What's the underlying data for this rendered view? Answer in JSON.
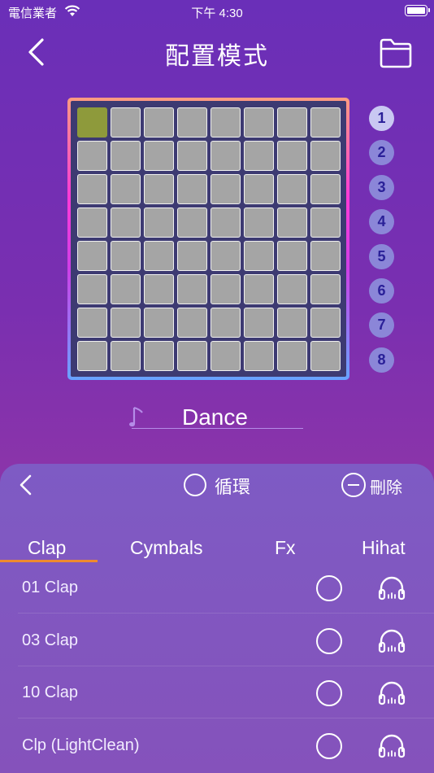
{
  "status_bar": {
    "carrier": "電信業者",
    "time": "下午 4:30"
  },
  "header": {
    "title": "配置模式"
  },
  "grid": {
    "rows": 8,
    "cols": 8,
    "active_pad": {
      "row": 1,
      "col": 1
    },
    "active_color": "#8e9a3b"
  },
  "pages": {
    "labels": [
      "1",
      "2",
      "3",
      "4",
      "5",
      "6",
      "7",
      "8"
    ],
    "active": "1"
  },
  "name_field": {
    "value": "Dance"
  },
  "panel": {
    "loop_label": "循環",
    "delete_label": "刪除",
    "tabs": [
      "Clap",
      "Cymbals",
      "Fx",
      "Hihat"
    ],
    "active_tab": "Clap",
    "sounds": [
      "01 Clap",
      "03 Clap",
      "10 Clap",
      "Clp (LightClean)"
    ]
  },
  "colors": {
    "accent_underline": "#f08a2e",
    "page_button": "#8b86d8",
    "page_button_active": "#c9c8f2"
  }
}
